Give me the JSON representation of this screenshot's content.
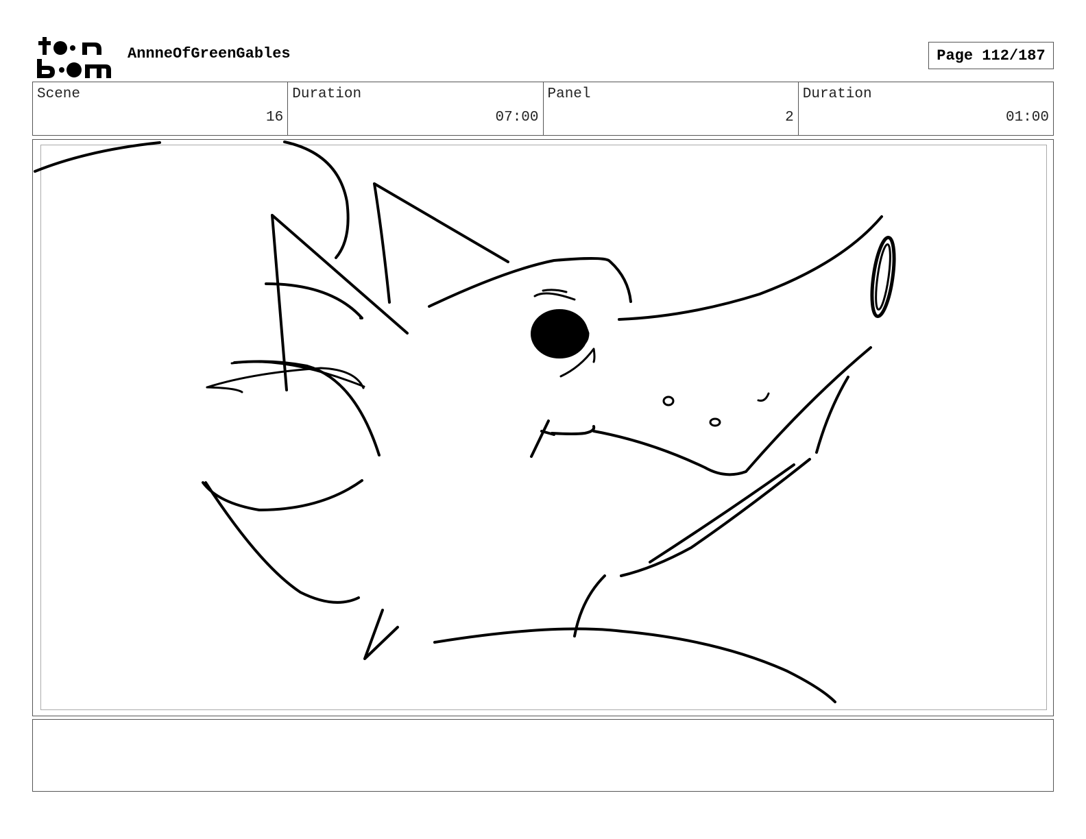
{
  "header": {
    "project_title": "AnnneOfGreenGables",
    "page_label": "Page 112/187"
  },
  "logo": {
    "icon": "toon-boom-logo",
    "text_line1": "toon",
    "text_line2": "boom"
  },
  "info": {
    "scene_label": "Scene",
    "scene_value": "16",
    "scene_duration_label": "Duration",
    "scene_duration_value": "07:00",
    "panel_label": "Panel",
    "panel_value": "2",
    "panel_duration_label": "Duration",
    "panel_duration_value": "01:00"
  },
  "panel": {
    "image": "fox-head-sketch"
  },
  "notes": {
    "text": ""
  }
}
